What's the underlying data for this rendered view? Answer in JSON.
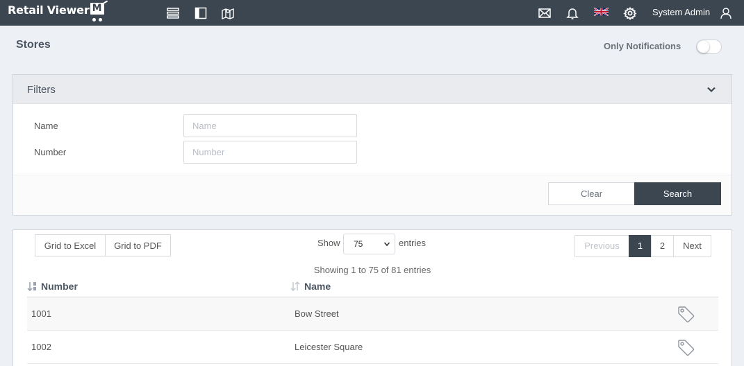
{
  "topbar": {
    "logo_text": "Retail Viewer",
    "logo_badge": "M",
    "user_name": "System Admin",
    "icons": [
      "list-icon",
      "book-icon",
      "map-icon",
      "mail-icon",
      "bell-icon",
      "uk-flag-icon",
      "gear-icon",
      "user-icon"
    ]
  },
  "page": {
    "title": "Stores",
    "only_notifications_label": "Only Notifications",
    "only_notifications_on": false
  },
  "filters": {
    "title": "Filters",
    "name_label": "Name",
    "name_placeholder": "Name",
    "name_value": "",
    "number_label": "Number",
    "number_placeholder": "Number",
    "number_value": "",
    "clear_label": "Clear",
    "search_label": "Search"
  },
  "grid": {
    "export_excel": "Grid to Excel",
    "export_pdf": "Grid to PDF",
    "show_label": "Show",
    "page_size": "75",
    "entries_label": "entries",
    "showing_text": "Showing 1 to 75 of 81 entries",
    "pagination": {
      "previous": "Previous",
      "pages": [
        "1",
        "2"
      ],
      "current": "1",
      "next": "Next"
    },
    "columns": [
      "Number",
      "Name"
    ],
    "rows": [
      {
        "number": "1001",
        "name": "Bow Street"
      },
      {
        "number": "1002",
        "name": "Leicester Square"
      }
    ]
  },
  "colors": {
    "topbar": "#3c4651",
    "background": "#edf0f4",
    "primary_button": "#3c4651"
  }
}
